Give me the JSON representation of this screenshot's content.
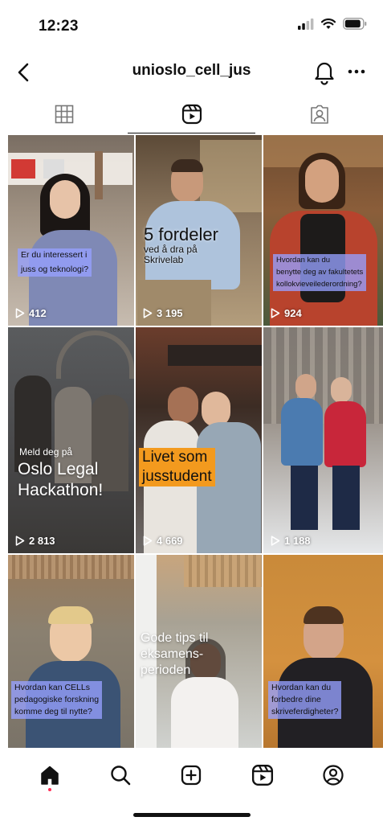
{
  "status_bar": {
    "time": "12:23"
  },
  "header": {
    "username": "unioslo_cell_jus"
  },
  "tabs": [
    "grid",
    "reels",
    "tagged"
  ],
  "reels": [
    {
      "caption_lines": [
        "Er du interessert i",
        "juss og teknologi?"
      ],
      "views": "412"
    },
    {
      "title": "5 fordeler",
      "subtitle_lines": [
        "ved å dra på",
        "Skrivelab"
      ],
      "views": "3 195"
    },
    {
      "caption_lines": [
        "Hvordan kan du",
        "benytte deg av fakultetets",
        "kollokvieveilederordning?"
      ],
      "views": "924"
    },
    {
      "small": "Meld deg på",
      "title_lines": [
        "Oslo Legal",
        "Hackathon!"
      ],
      "views": "2 813"
    },
    {
      "title_lines": [
        "Livet som",
        "jusstudent"
      ],
      "views": "4 669"
    },
    {
      "views": "1 188"
    },
    {
      "caption_lines": [
        "Hvordan kan CELLs",
        "pedagogiske forskning",
        "komme deg til nytte?"
      ]
    },
    {
      "title_lines": [
        "Gode tips til",
        "eksamens-",
        "perioden"
      ]
    },
    {
      "caption_lines": [
        "Hvordan kan du",
        "forbedre dine",
        "skriveferdigheter?"
      ]
    }
  ],
  "colors": {
    "caption_box": "#9aa3ff",
    "highlight_box": "#f39a1e",
    "notification_dot": "#ff2d55"
  },
  "bottom_nav": [
    "home-icon",
    "search-icon",
    "create-icon",
    "reels-icon",
    "profile-icon"
  ]
}
